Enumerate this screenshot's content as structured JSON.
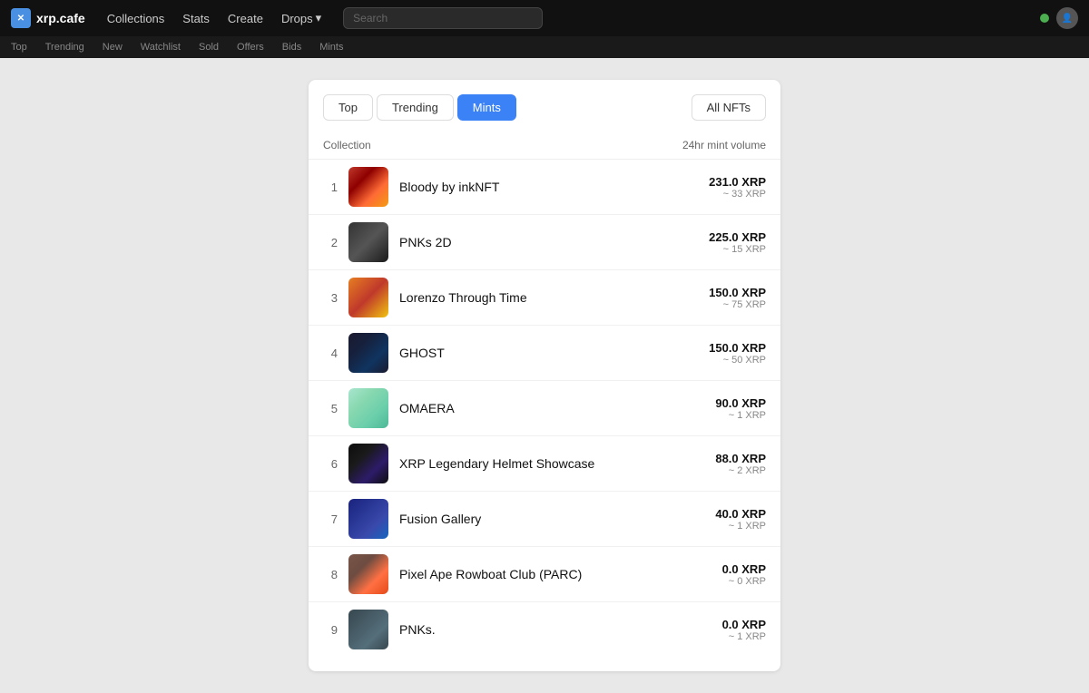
{
  "navbar": {
    "logo_text": "xrp.cafe",
    "links": [
      {
        "label": "Collections"
      },
      {
        "label": "Stats"
      },
      {
        "label": "Create"
      },
      {
        "label": "Drops"
      }
    ],
    "search_placeholder": "Search"
  },
  "sub_nav": {
    "items": [
      "Top",
      "Trending",
      "New",
      "Watchlist",
      "Sold",
      "Offers",
      "Bids",
      "Mints"
    ]
  },
  "tabs": {
    "items": [
      {
        "label": "Top",
        "active": false
      },
      {
        "label": "Trending",
        "active": false
      },
      {
        "label": "Mints",
        "active": true
      }
    ],
    "all_nfts_label": "All NFTs"
  },
  "table": {
    "col_collection": "Collection",
    "col_volume": "24hr mint volume",
    "rows": [
      {
        "rank": "1",
        "name": "Bloody by inkNFT",
        "vol_main": "231.0 XRP",
        "vol_sub": "~ 33 XRP",
        "thumb_class": "thumb-1"
      },
      {
        "rank": "2",
        "name": "PNKs 2D",
        "vol_main": "225.0 XRP",
        "vol_sub": "~ 15 XRP",
        "thumb_class": "thumb-2"
      },
      {
        "rank": "3",
        "name": "Lorenzo Through Time",
        "vol_main": "150.0 XRP",
        "vol_sub": "~ 75 XRP",
        "thumb_class": "thumb-3"
      },
      {
        "rank": "4",
        "name": "GHOST",
        "vol_main": "150.0 XRP",
        "vol_sub": "~ 50 XRP",
        "thumb_class": "thumb-4"
      },
      {
        "rank": "5",
        "name": "OMAERA",
        "vol_main": "90.0 XRP",
        "vol_sub": "~ 1 XRP",
        "thumb_class": "thumb-5"
      },
      {
        "rank": "6",
        "name": "XRP Legendary Helmet Showcase",
        "vol_main": "88.0 XRP",
        "vol_sub": "~ 2 XRP",
        "thumb_class": "thumb-6"
      },
      {
        "rank": "7",
        "name": "Fusion Gallery",
        "vol_main": "40.0 XRP",
        "vol_sub": "~ 1 XRP",
        "thumb_class": "thumb-7"
      },
      {
        "rank": "8",
        "name": "Pixel Ape Rowboat Club (PARC)",
        "vol_main": "0.0 XRP",
        "vol_sub": "~ 0 XRP",
        "thumb_class": "thumb-8"
      },
      {
        "rank": "9",
        "name": "PNKs.",
        "vol_main": "0.0 XRP",
        "vol_sub": "~ 1 XRP",
        "thumb_class": "thumb-9"
      }
    ]
  }
}
